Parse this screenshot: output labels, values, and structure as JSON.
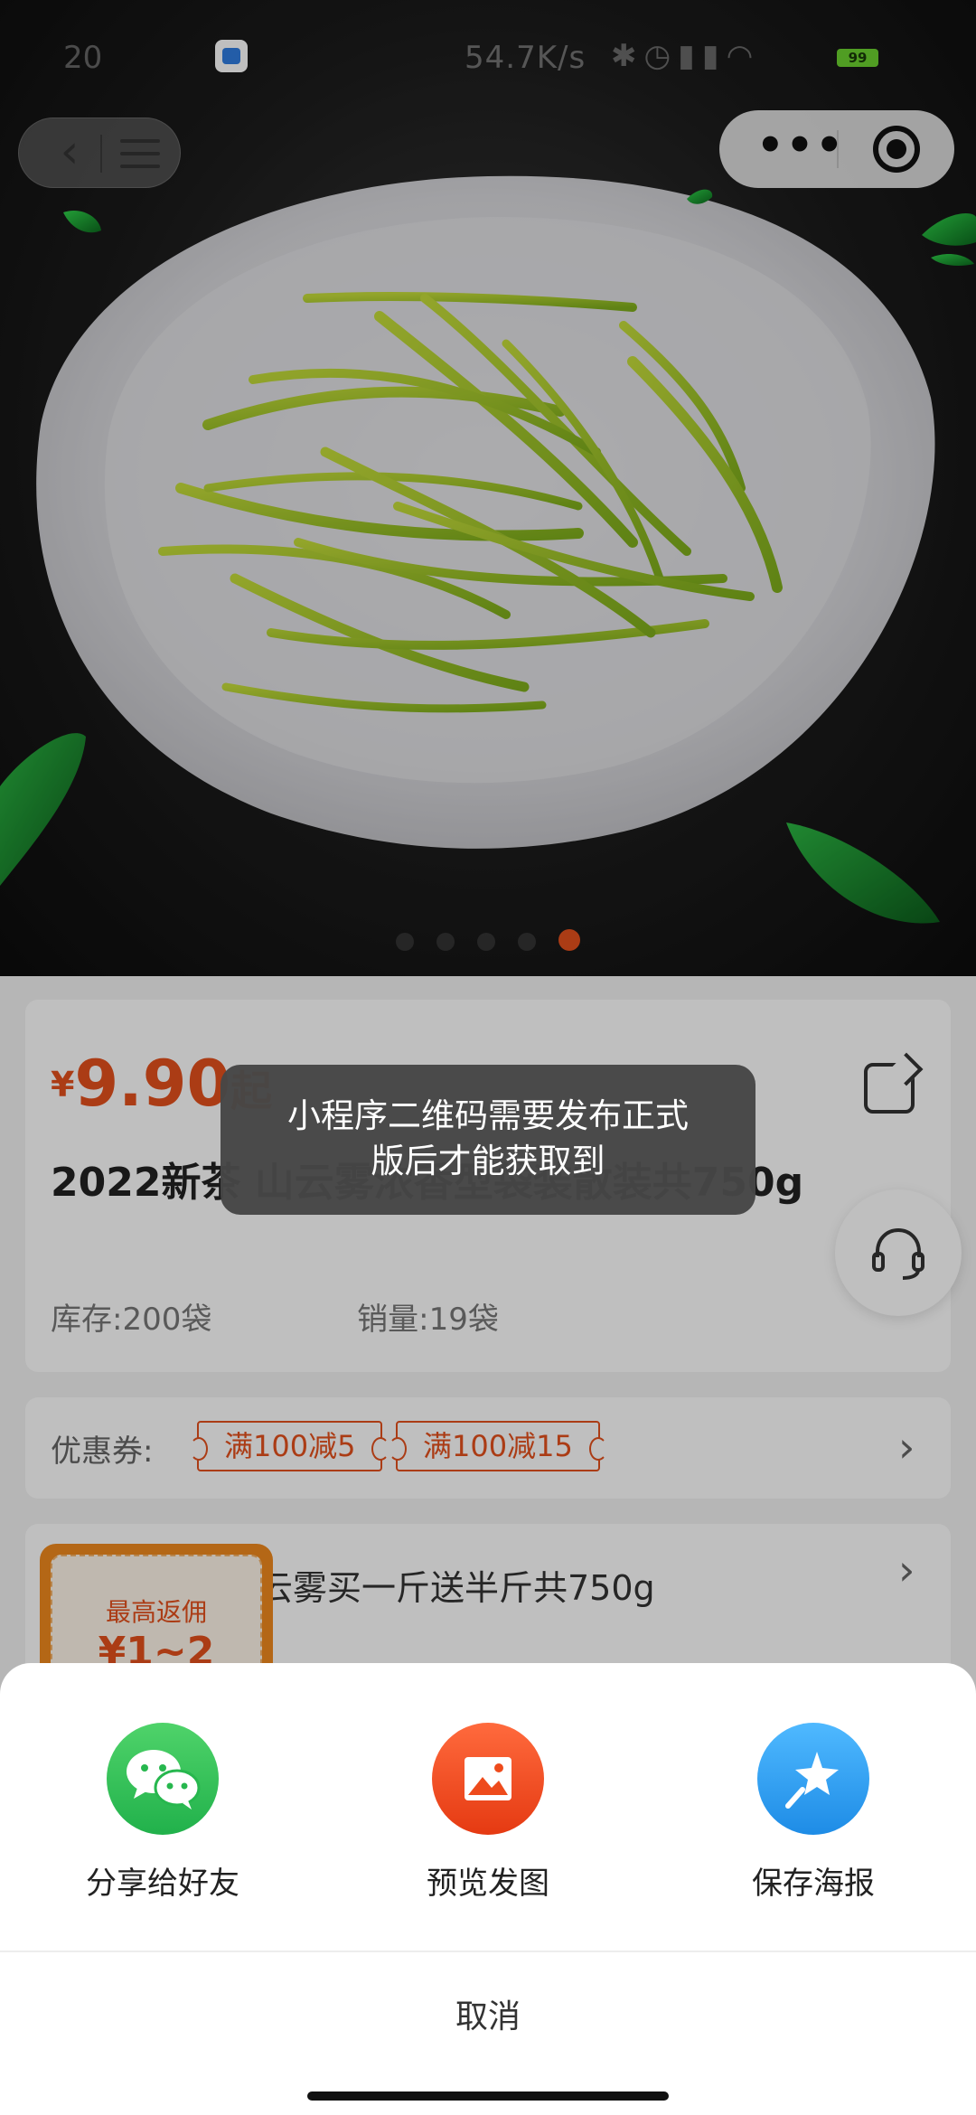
{
  "status_bar": {
    "left_text": "20",
    "speed": "54.7K/s",
    "icons": [
      "bluetooth-icon",
      "alarm-icon",
      "signal-icon",
      "signal-icon",
      "wifi-icon"
    ],
    "battery": "99"
  },
  "nav": {
    "back": "‹",
    "more": "•••"
  },
  "carousel": {
    "total": 5,
    "active_index": 4
  },
  "product": {
    "price_symbol": "¥",
    "price": "9.90",
    "price_suffix": "起",
    "title": "2022新茶                                         山云雾浓香型袋装散装共750g",
    "stock": "库存:200袋",
    "sales": "销量:19袋"
  },
  "coupons": {
    "label": "优惠券:",
    "items": [
      "满100减5",
      "满100减15"
    ]
  },
  "spec": {
    "text": "云雾买一斤送半斤共750g"
  },
  "rebate": {
    "title": "最高返佣",
    "amount": "¥1~2"
  },
  "toast": {
    "line1": "小程序二维码需要发布正式",
    "line2": "版后才能获取到"
  },
  "share_sheet": {
    "items": [
      {
        "label": "分享给好友",
        "icon": "wechat-icon"
      },
      {
        "label": "预览发图",
        "icon": "image-icon"
      },
      {
        "label": "保存海报",
        "icon": "star-wand-icon"
      }
    ],
    "cancel": "取消"
  },
  "colors": {
    "accent": "#e5501d",
    "wechat": "#21b14b",
    "poster": "#1e8ce6"
  }
}
